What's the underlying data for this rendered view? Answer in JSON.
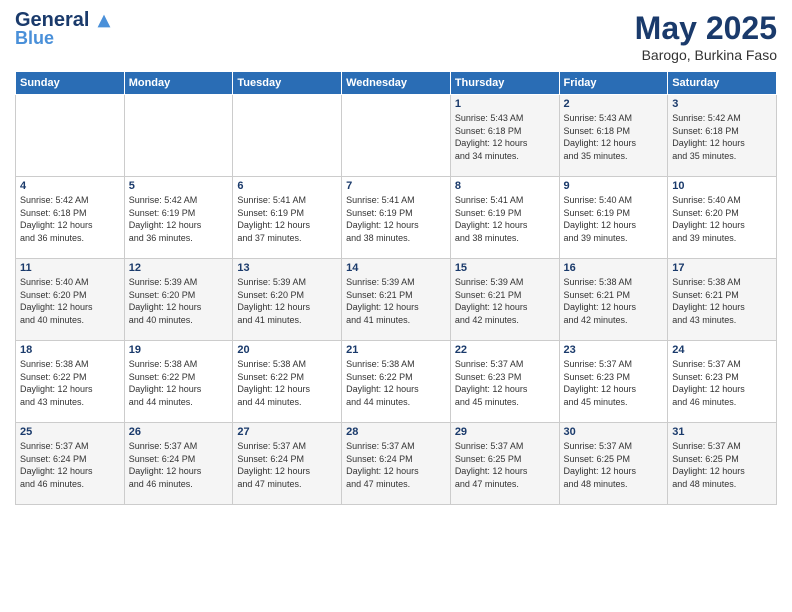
{
  "header": {
    "logo_general": "General",
    "logo_blue": "Blue",
    "month": "May 2025",
    "location": "Barogo, Burkina Faso"
  },
  "weekdays": [
    "Sunday",
    "Monday",
    "Tuesday",
    "Wednesday",
    "Thursday",
    "Friday",
    "Saturday"
  ],
  "weeks": [
    [
      {
        "day": "",
        "info": ""
      },
      {
        "day": "",
        "info": ""
      },
      {
        "day": "",
        "info": ""
      },
      {
        "day": "",
        "info": ""
      },
      {
        "day": "1",
        "info": "Sunrise: 5:43 AM\nSunset: 6:18 PM\nDaylight: 12 hours\nand 34 minutes."
      },
      {
        "day": "2",
        "info": "Sunrise: 5:43 AM\nSunset: 6:18 PM\nDaylight: 12 hours\nand 35 minutes."
      },
      {
        "day": "3",
        "info": "Sunrise: 5:42 AM\nSunset: 6:18 PM\nDaylight: 12 hours\nand 35 minutes."
      }
    ],
    [
      {
        "day": "4",
        "info": "Sunrise: 5:42 AM\nSunset: 6:18 PM\nDaylight: 12 hours\nand 36 minutes."
      },
      {
        "day": "5",
        "info": "Sunrise: 5:42 AM\nSunset: 6:19 PM\nDaylight: 12 hours\nand 36 minutes."
      },
      {
        "day": "6",
        "info": "Sunrise: 5:41 AM\nSunset: 6:19 PM\nDaylight: 12 hours\nand 37 minutes."
      },
      {
        "day": "7",
        "info": "Sunrise: 5:41 AM\nSunset: 6:19 PM\nDaylight: 12 hours\nand 38 minutes."
      },
      {
        "day": "8",
        "info": "Sunrise: 5:41 AM\nSunset: 6:19 PM\nDaylight: 12 hours\nand 38 minutes."
      },
      {
        "day": "9",
        "info": "Sunrise: 5:40 AM\nSunset: 6:19 PM\nDaylight: 12 hours\nand 39 minutes."
      },
      {
        "day": "10",
        "info": "Sunrise: 5:40 AM\nSunset: 6:20 PM\nDaylight: 12 hours\nand 39 minutes."
      }
    ],
    [
      {
        "day": "11",
        "info": "Sunrise: 5:40 AM\nSunset: 6:20 PM\nDaylight: 12 hours\nand 40 minutes."
      },
      {
        "day": "12",
        "info": "Sunrise: 5:39 AM\nSunset: 6:20 PM\nDaylight: 12 hours\nand 40 minutes."
      },
      {
        "day": "13",
        "info": "Sunrise: 5:39 AM\nSunset: 6:20 PM\nDaylight: 12 hours\nand 41 minutes."
      },
      {
        "day": "14",
        "info": "Sunrise: 5:39 AM\nSunset: 6:21 PM\nDaylight: 12 hours\nand 41 minutes."
      },
      {
        "day": "15",
        "info": "Sunrise: 5:39 AM\nSunset: 6:21 PM\nDaylight: 12 hours\nand 42 minutes."
      },
      {
        "day": "16",
        "info": "Sunrise: 5:38 AM\nSunset: 6:21 PM\nDaylight: 12 hours\nand 42 minutes."
      },
      {
        "day": "17",
        "info": "Sunrise: 5:38 AM\nSunset: 6:21 PM\nDaylight: 12 hours\nand 43 minutes."
      }
    ],
    [
      {
        "day": "18",
        "info": "Sunrise: 5:38 AM\nSunset: 6:22 PM\nDaylight: 12 hours\nand 43 minutes."
      },
      {
        "day": "19",
        "info": "Sunrise: 5:38 AM\nSunset: 6:22 PM\nDaylight: 12 hours\nand 44 minutes."
      },
      {
        "day": "20",
        "info": "Sunrise: 5:38 AM\nSunset: 6:22 PM\nDaylight: 12 hours\nand 44 minutes."
      },
      {
        "day": "21",
        "info": "Sunrise: 5:38 AM\nSunset: 6:22 PM\nDaylight: 12 hours\nand 44 minutes."
      },
      {
        "day": "22",
        "info": "Sunrise: 5:37 AM\nSunset: 6:23 PM\nDaylight: 12 hours\nand 45 minutes."
      },
      {
        "day": "23",
        "info": "Sunrise: 5:37 AM\nSunset: 6:23 PM\nDaylight: 12 hours\nand 45 minutes."
      },
      {
        "day": "24",
        "info": "Sunrise: 5:37 AM\nSunset: 6:23 PM\nDaylight: 12 hours\nand 46 minutes."
      }
    ],
    [
      {
        "day": "25",
        "info": "Sunrise: 5:37 AM\nSunset: 6:24 PM\nDaylight: 12 hours\nand 46 minutes."
      },
      {
        "day": "26",
        "info": "Sunrise: 5:37 AM\nSunset: 6:24 PM\nDaylight: 12 hours\nand 46 minutes."
      },
      {
        "day": "27",
        "info": "Sunrise: 5:37 AM\nSunset: 6:24 PM\nDaylight: 12 hours\nand 47 minutes."
      },
      {
        "day": "28",
        "info": "Sunrise: 5:37 AM\nSunset: 6:24 PM\nDaylight: 12 hours\nand 47 minutes."
      },
      {
        "day": "29",
        "info": "Sunrise: 5:37 AM\nSunset: 6:25 PM\nDaylight: 12 hours\nand 47 minutes."
      },
      {
        "day": "30",
        "info": "Sunrise: 5:37 AM\nSunset: 6:25 PM\nDaylight: 12 hours\nand 48 minutes."
      },
      {
        "day": "31",
        "info": "Sunrise: 5:37 AM\nSunset: 6:25 PM\nDaylight: 12 hours\nand 48 minutes."
      }
    ]
  ]
}
